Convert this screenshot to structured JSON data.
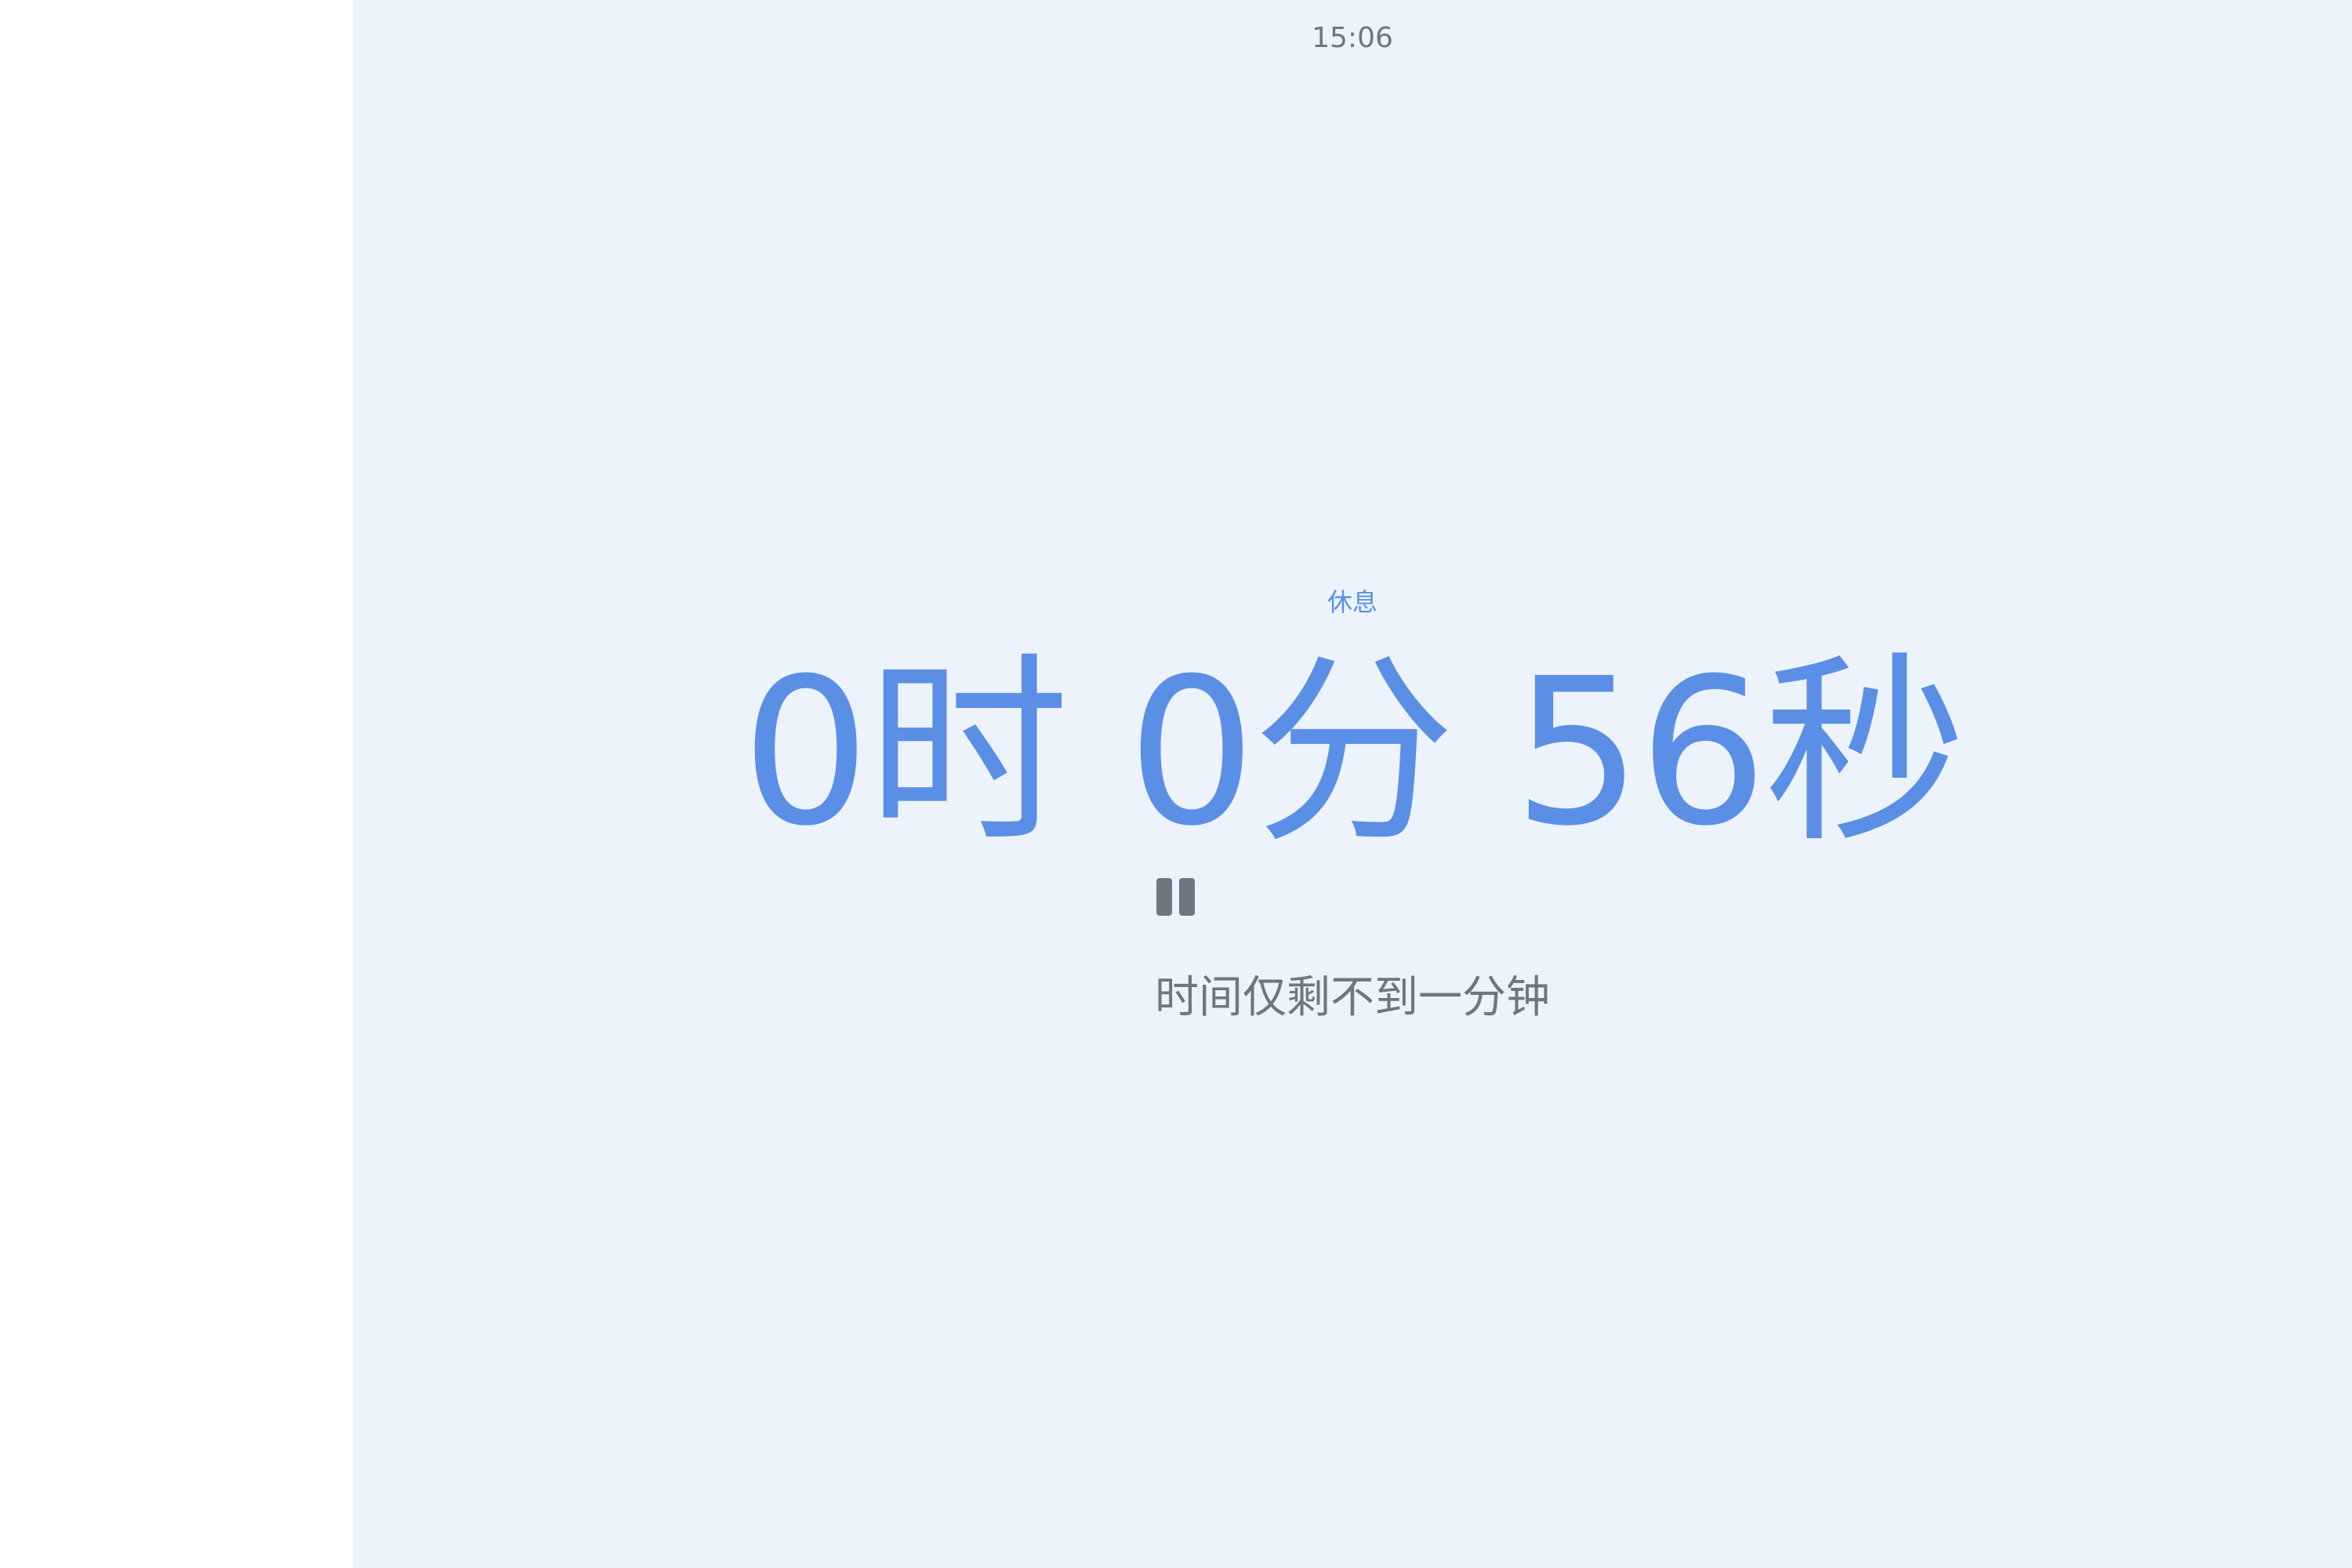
{
  "status": {
    "clock": "15:06"
  },
  "timer": {
    "mode_label": "休息",
    "countdown": "0时 0分 56秒",
    "remaining": {
      "hours": 0,
      "minutes": 0,
      "seconds": 56
    },
    "state": "running",
    "pause_icon": "pause-icon",
    "message": "时间仅剩不到一分钟"
  },
  "colors": {
    "background": "#ecf3fd",
    "accent": "#5b8fe6",
    "muted_text": "#707680"
  }
}
